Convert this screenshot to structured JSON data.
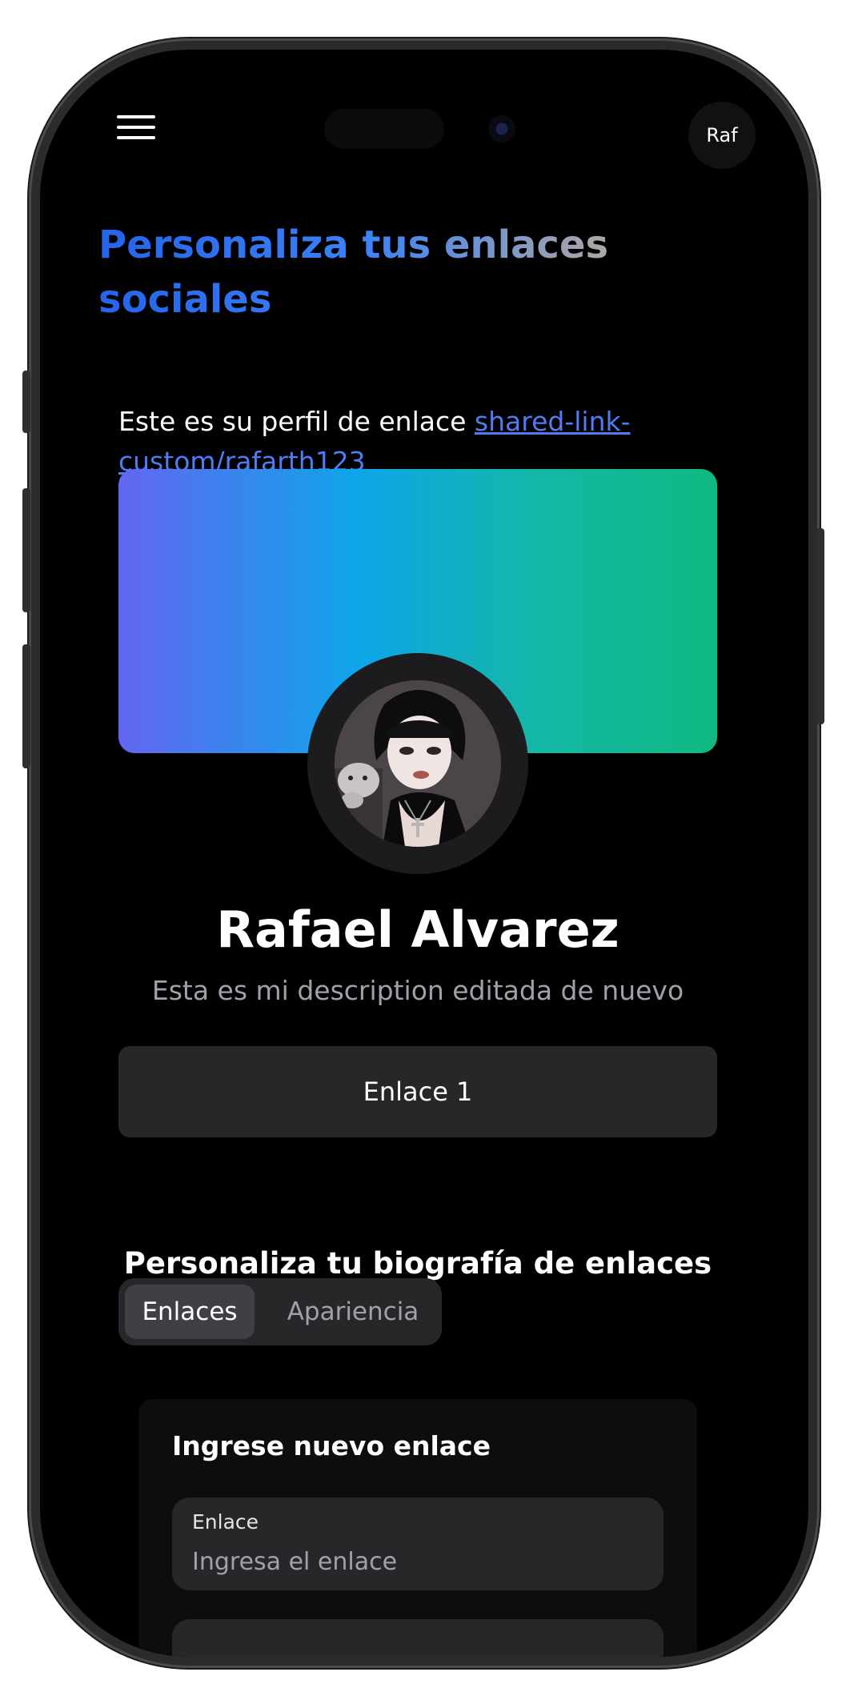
{
  "header": {
    "avatar_text": "Raf"
  },
  "page": {
    "title": "Personaliza tus enlaces sociales",
    "intro_text": "Este es su perfil de enlace ",
    "profile_link": "shared-link-custom/rafarth123"
  },
  "profile": {
    "name": "Rafael Alvarez",
    "description": "Esta es mi description editada de nuevo",
    "links": [
      {
        "label": "Enlace 1"
      }
    ]
  },
  "customize": {
    "title": "Personaliza tu biografía de enlaces",
    "tabs": [
      {
        "label": "Enlaces",
        "active": true
      },
      {
        "label": "Apariencia",
        "active": false
      }
    ]
  },
  "new_link_form": {
    "title": "Ingrese nuevo enlace",
    "field_label": "Enlace",
    "field_placeholder": "Ingresa el enlace"
  },
  "colors": {
    "background": "#000000",
    "title_gradient": [
      "#2563eb",
      "#3b82f6",
      "#d6b48a"
    ],
    "banner_gradient": [
      "#6366f1",
      "#0ea5e9",
      "#14b8a6",
      "#10b981"
    ],
    "link_color": "#4f7cf2",
    "surface": "#27272a"
  }
}
